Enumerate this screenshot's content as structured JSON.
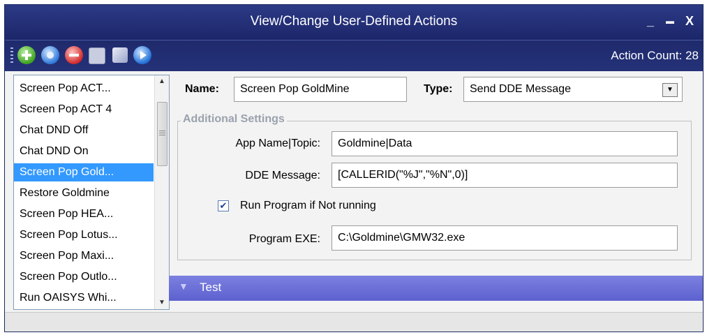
{
  "window": {
    "title": "View/Change User-Defined Actions",
    "minimize_glyph": "_",
    "maximize_glyph": "▬",
    "close_glyph": "X"
  },
  "toolbar": {
    "icons": [
      "add-icon",
      "edit-icon",
      "delete-icon",
      "save-icon",
      "copy-icon",
      "run-icon"
    ],
    "action_count": "Action Count: 28"
  },
  "action_list": {
    "items": [
      "Screen Pop ACT...",
      "Screen Pop ACT 4",
      "Chat DND Off",
      "Chat DND On",
      "Screen Pop Gold...",
      "Restore Goldmine",
      "Screen Pop HEA...",
      "Screen Pop Lotus...",
      "Screen Pop Maxi...",
      "Screen Pop Outlo...",
      "Run OAISYS Whi..."
    ],
    "selected": "Screen Pop Gold..."
  },
  "details": {
    "name_label": "Name:",
    "name_value": "Screen Pop GoldMine",
    "type_label": "Type:",
    "type_value": "Send DDE Message",
    "group_title": "Additional Settings",
    "app_topic_label": "App Name|Topic:",
    "app_topic_value": "Goldmine|Data",
    "dde_label": "DDE Message:",
    "dde_value": "[CALLERID(\"%J\",\"%N\",0)]",
    "run_program_label": "Run Program if Not running",
    "run_program_checked": true,
    "program_exe_label": "Program EXE:",
    "program_exe_value": "C:\\Goldmine\\GMW32.exe"
  },
  "test_section": {
    "label": "Test"
  },
  "colors": {
    "title_bar": "#23307a",
    "selection": "#3399ff",
    "test_bar": "#6b6fd8",
    "group_label": "#9aa2ad"
  }
}
